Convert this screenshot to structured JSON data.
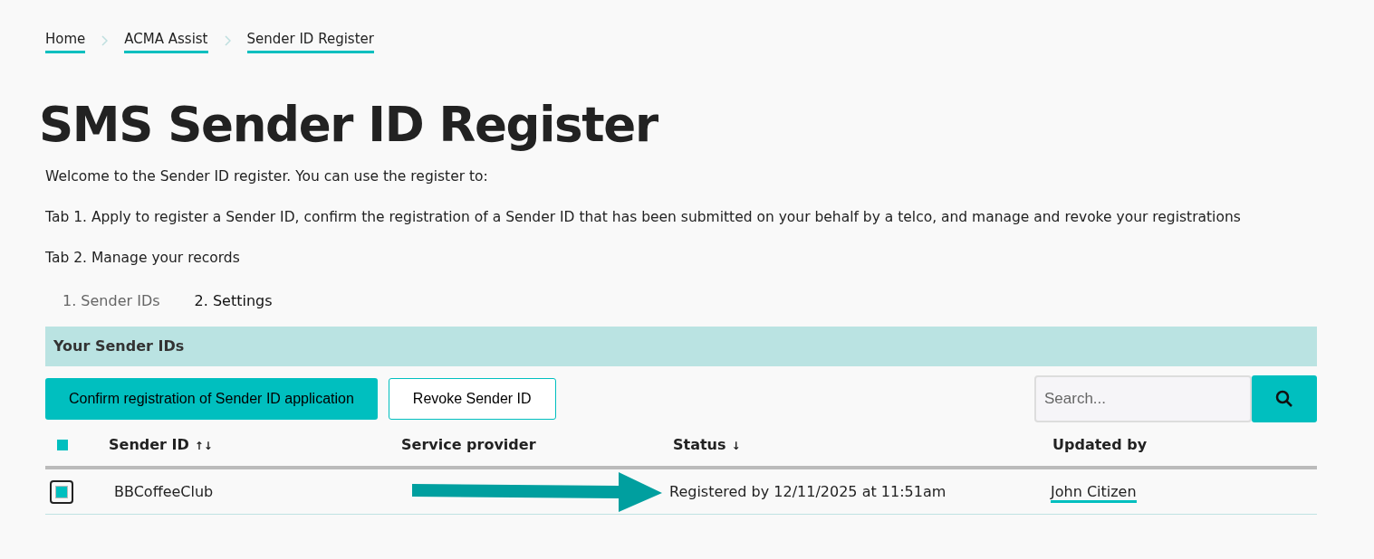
{
  "breadcrumbs": [
    {
      "label": "Home"
    },
    {
      "label": "ACMA Assist"
    },
    {
      "label": "Sender ID Register"
    }
  ],
  "title": "SMS Sender ID Register",
  "intro": [
    "Welcome to the Sender ID register. You can use the register to:",
    "Tab 1. Apply to register a Sender ID, confirm the registration of a Sender ID that has been submitted on your behalf by a telco, and manage and revoke your registrations",
    "Tab 2. Manage your records"
  ],
  "tabs": [
    {
      "label": "1. Sender IDs",
      "selected": true
    },
    {
      "label": "2. Settings",
      "selected": false
    }
  ],
  "panel": {
    "title": "Your Sender IDs"
  },
  "buttons": [
    {
      "label": "Confirm registration of Sender ID application",
      "kind": "primary"
    },
    {
      "label": "Revoke Sender ID",
      "kind": "outline"
    }
  ],
  "search": {
    "placeholder": "Search..."
  },
  "table": {
    "select_all": {
      "checked": true
    },
    "columns": [
      {
        "label": "Sender ID",
        "sort": "↑↓"
      },
      {
        "label": "Service provider"
      },
      {
        "label": "Status",
        "sort": "↓"
      },
      {
        "label": "Updated by"
      }
    ],
    "rows": [
      {
        "checked": true,
        "sender_id": "BBCoffeeClub",
        "status": "Registered by 12/11/2025 at 11:51am",
        "updated_by": "John Citizen"
      }
    ]
  }
}
